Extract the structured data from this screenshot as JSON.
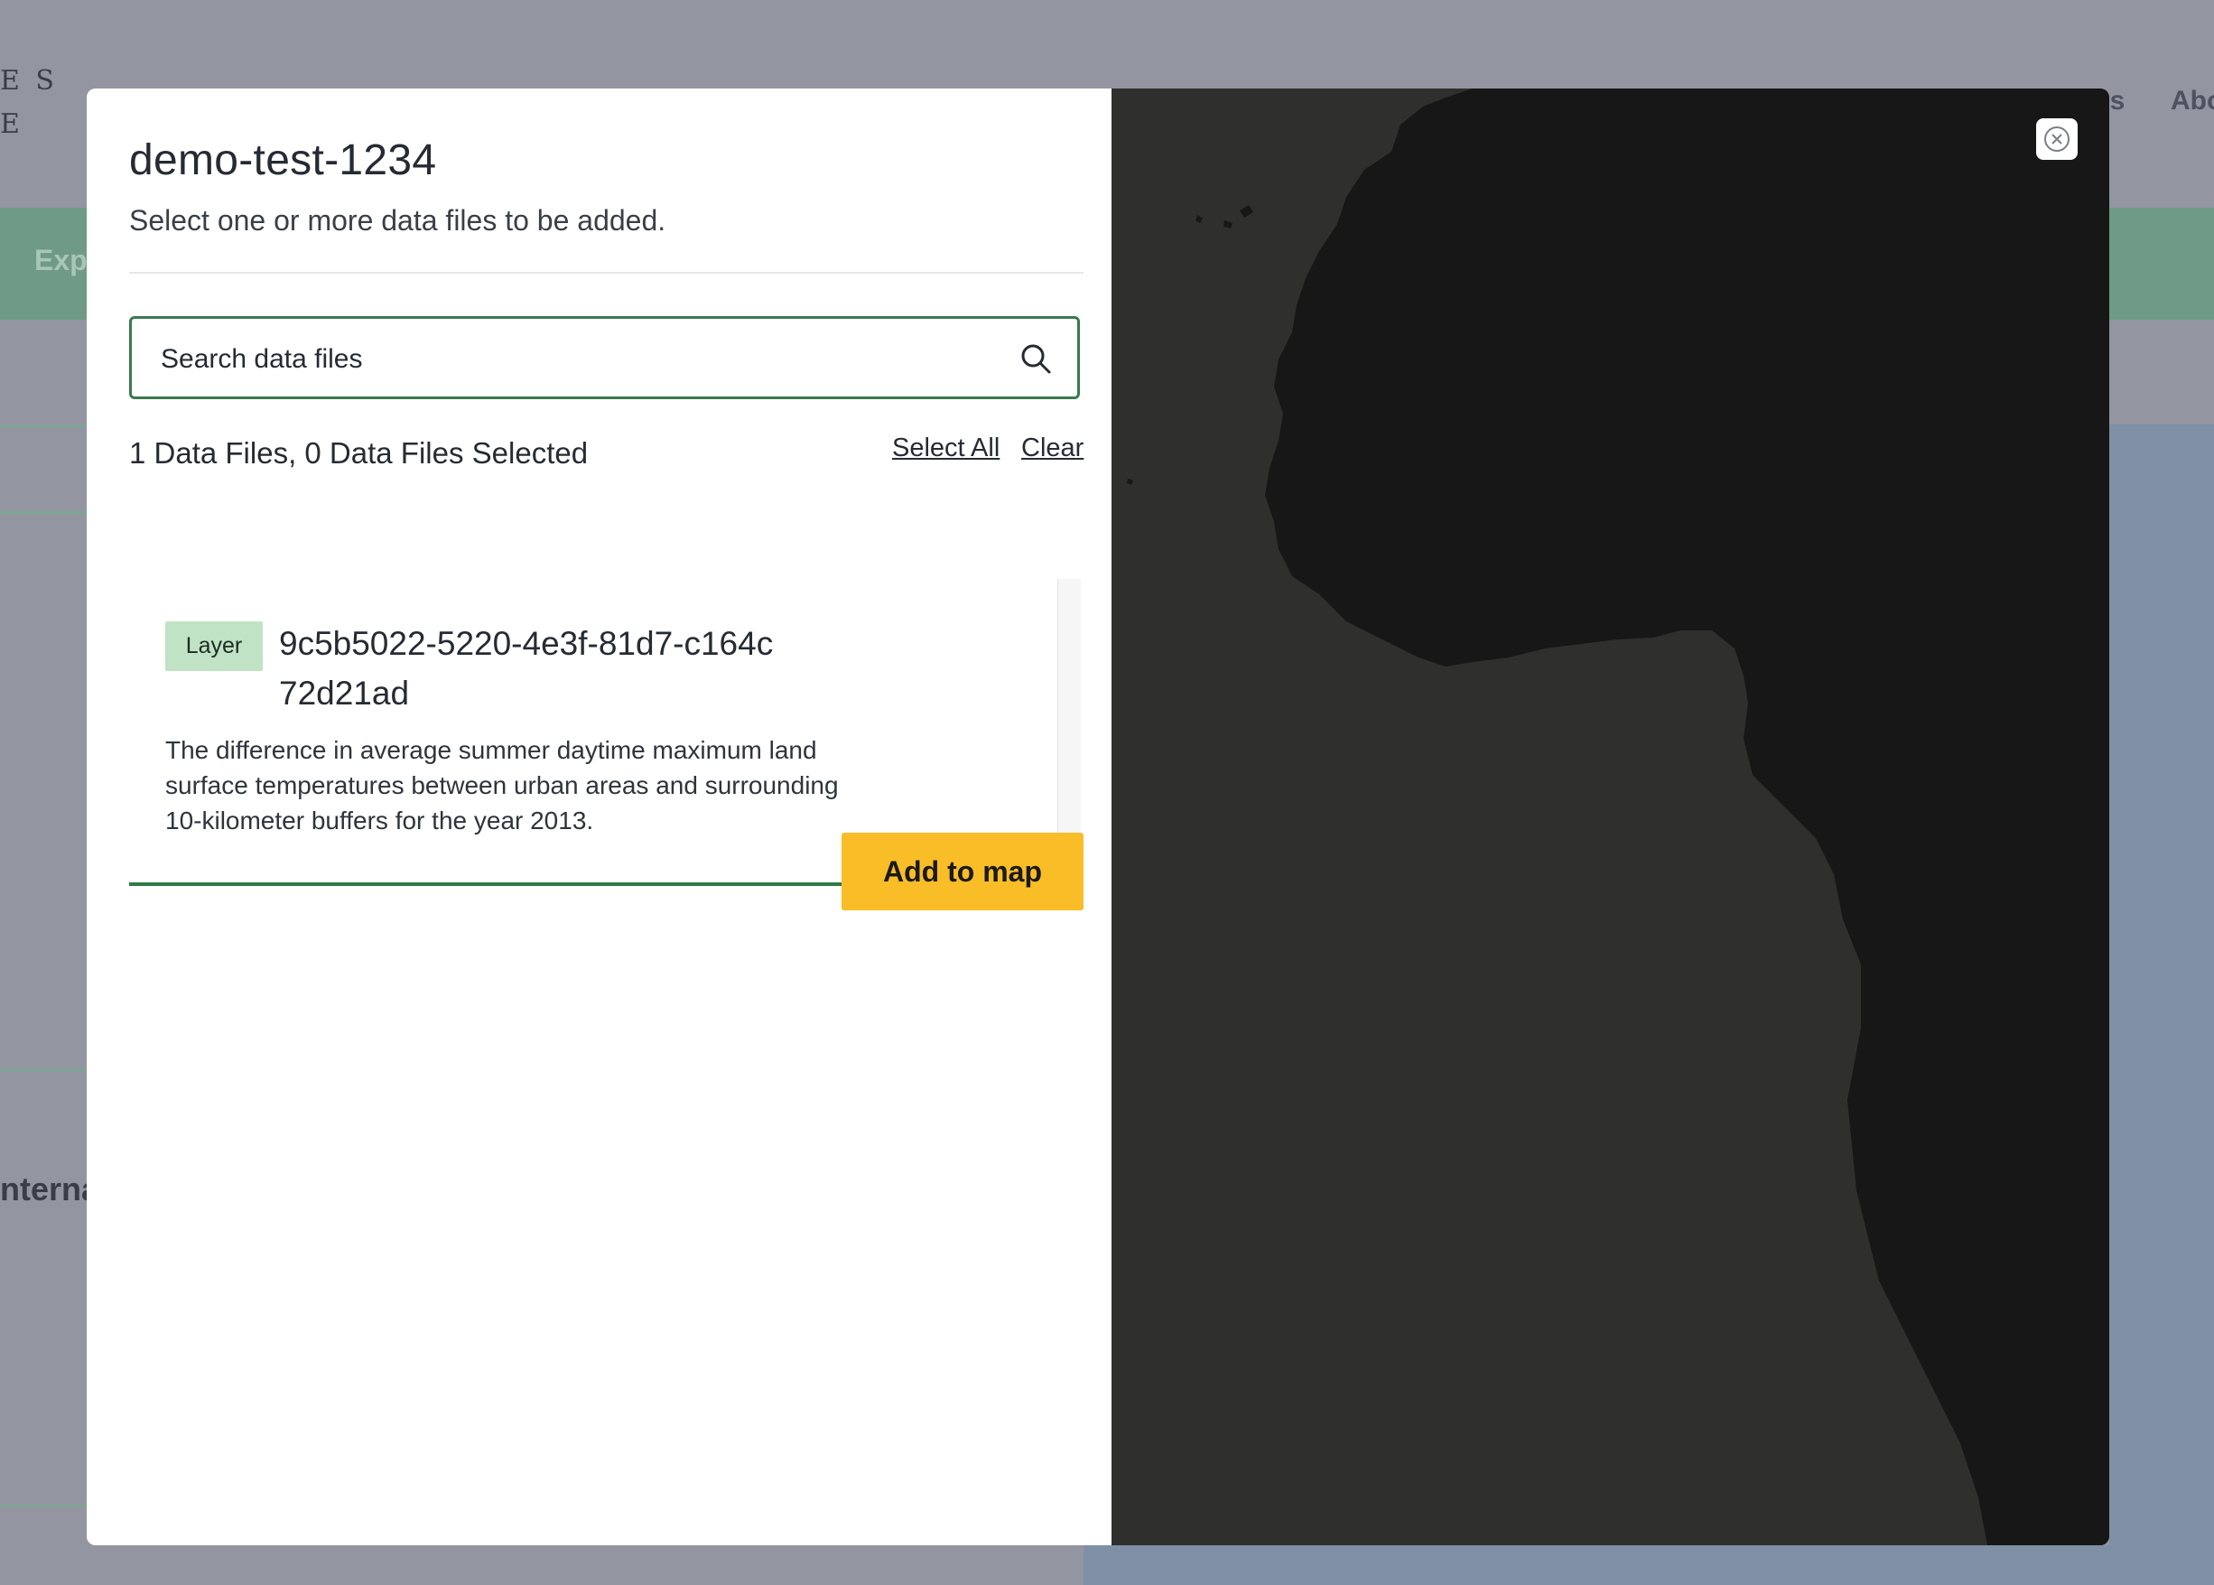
{
  "background": {
    "logo_lines": [
      "E S",
      "E"
    ],
    "nav": [
      "cs",
      "Abo"
    ],
    "explore_label": "Expl",
    "section_label": "nterna"
  },
  "modal": {
    "title": "demo-test-1234",
    "subtitle": "Select one or more data files to be added.",
    "search": {
      "placeholder": "Search data files",
      "value": ""
    },
    "count_text": "1 Data Files, 0 Data Files Selected",
    "select_all_label": "Select All",
    "clear_label": "Clear",
    "files": [
      {
        "badge": "Layer",
        "id": "9c5b5022-5220-4e3f-81d7-c164c72d21ad",
        "description": "The difference in average summer daytime maximum land surface temperatures between urban areas and surrounding 10-kilometer buffers for the year 2013."
      }
    ],
    "add_button_label": "Add to map",
    "close_icon": "close-icon",
    "search_icon": "search-icon"
  },
  "colors": {
    "accent_green": "#2e7a45",
    "badge_bg": "#bfe3c4",
    "button_yellow": "#f9bd27",
    "map_ocean": "#2f2f2d",
    "map_land": "#161716"
  }
}
